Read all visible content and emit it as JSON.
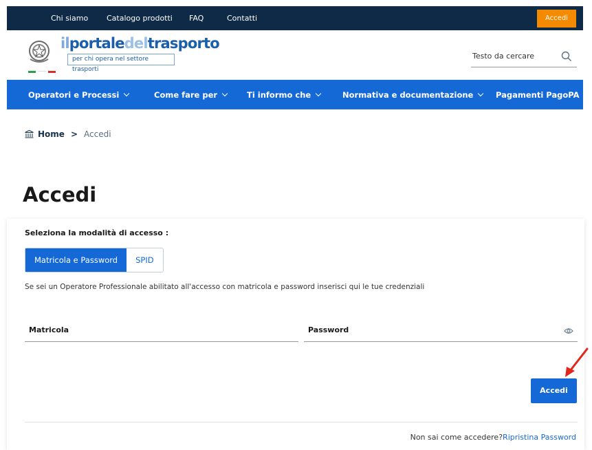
{
  "topbar": {
    "links": [
      "Chi siamo",
      "Catalogo prodotti",
      "FAQ",
      "Contatti"
    ],
    "login_label": "Accedi",
    "login_color": "#f38a00"
  },
  "header": {
    "logo_parts": {
      "a": "il",
      "b": "portale",
      "c": "del",
      "d": "trasporto"
    },
    "logo_subtitle": "per chi opera nel settore trasporti",
    "search_placeholder": "Testo da cercare",
    "search_icon": "search-icon"
  },
  "nav": {
    "items": [
      "Operatori e Processi",
      "Come fare per",
      "Ti informo che",
      "Normativa e documentazione",
      "Pagamenti PagoPA"
    ],
    "color": "#1469d7"
  },
  "breadcrumb": {
    "home": "Home",
    "separator": ">",
    "current": "Accedi"
  },
  "page": {
    "title": "Accedi"
  },
  "login_card": {
    "access_label": "Seleziona la modalità di accesso :",
    "tabs": [
      "Matricola e Password",
      "SPID"
    ],
    "active_tab": "Matricola e Password",
    "info_text": "Se sei un Operatore Professionale abilitato all'accesso con matricola e password inserisci qui le tue credenziali",
    "matricola_label": "Matricola",
    "password_label": "Password",
    "submit_label": "Accedi",
    "help_text": "Non sai come accedere?",
    "reset_link": "Ripristina Password"
  },
  "annotation": {
    "arrow_color": "#e1261c"
  }
}
